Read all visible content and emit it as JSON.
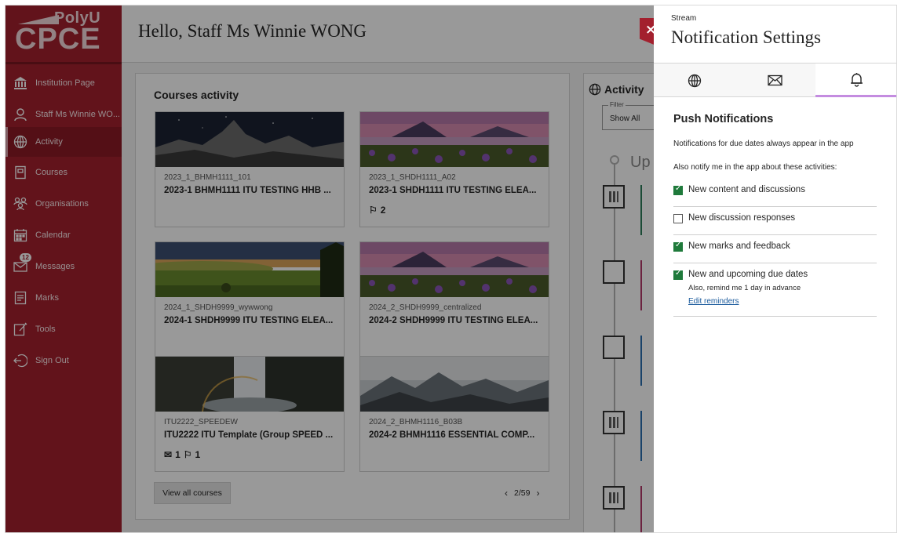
{
  "sidebar": {
    "logo_top": "PolyU",
    "logo_main": "CPCE",
    "items": [
      {
        "label": "Institution Page",
        "icon": "institution-icon"
      },
      {
        "label": "Staff Ms Winnie WO...",
        "icon": "user-icon"
      },
      {
        "label": "Activity",
        "icon": "globe-icon",
        "active": true
      },
      {
        "label": "Courses",
        "icon": "courses-icon"
      },
      {
        "label": "Organisations",
        "icon": "organisations-icon"
      },
      {
        "label": "Calendar",
        "icon": "calendar-icon"
      },
      {
        "label": "Messages",
        "icon": "envelope-icon",
        "badge": "12"
      },
      {
        "label": "Marks",
        "icon": "marks-icon"
      },
      {
        "label": "Tools",
        "icon": "tools-icon"
      },
      {
        "label": "Sign Out",
        "icon": "sign-out-icon"
      }
    ]
  },
  "header": {
    "greeting": "Hello, Staff Ms Winnie WONG"
  },
  "courses": {
    "title": "Courses activity",
    "cards": [
      {
        "code": "2023_1_BHMH1111_101",
        "title": "2023-1 BHMH1111 ITU TESTING HHB ...",
        "image": "mountain-night"
      },
      {
        "code": "2023_1_SHDH1111_A02",
        "title": "2023-1 SHDH1111 ITU TESTING ELEA...",
        "image": "lake-flowers",
        "flags": "2"
      },
      {
        "code": "2024_1_SHDH9999_wywwong",
        "title": "2024-1 SHDH9999 ITU TESTING ELEA...",
        "image": "sunset-field"
      },
      {
        "code": "2024_2_SHDH9999_centralized",
        "title": "2024-2 SHDH9999 ITU TESTING ELEA...",
        "image": "lake-flowers"
      },
      {
        "code": "ITU2222_SPEEDEW",
        "title": "ITU2222 ITU Template (Group SPEED ...",
        "image": "waterfall",
        "messages": "1",
        "flags": "1"
      },
      {
        "code": "2024_2_BHMH1116_B03B",
        "title": "2024-2 BHMH1116 ESSENTIAL COMP...",
        "image": "snowy-mountains"
      }
    ],
    "view_all": "View all courses",
    "page": "2/59"
  },
  "activity": {
    "title": "Activity",
    "filter_label": "Filter",
    "filter_value": "Show All",
    "upcoming": "Up"
  },
  "notification_panel": {
    "close": "×",
    "stream": "Stream",
    "title": "Notification Settings",
    "tabs": [
      {
        "name": "globe-icon"
      },
      {
        "name": "envelope-icon"
      },
      {
        "name": "bell-icon",
        "active": true
      }
    ],
    "heading": "Push Notifications",
    "note_due": "Notifications for due dates always appear in the app",
    "note_also": "Also notify me in the app about these activities:",
    "options": [
      {
        "label": "New content and discussions",
        "checked": true
      },
      {
        "label": "New discussion responses",
        "checked": false
      },
      {
        "label": "New marks and feedback",
        "checked": true
      },
      {
        "label": "New and upcoming due dates",
        "checked": true,
        "sub": "Also, remind me 1 day in advance",
        "link": "Edit reminders"
      }
    ]
  },
  "colors": {
    "brand": "#a3202e",
    "check": "#1f7a3b",
    "tab_active": "#c48ce0",
    "link": "#1a5a9c"
  }
}
